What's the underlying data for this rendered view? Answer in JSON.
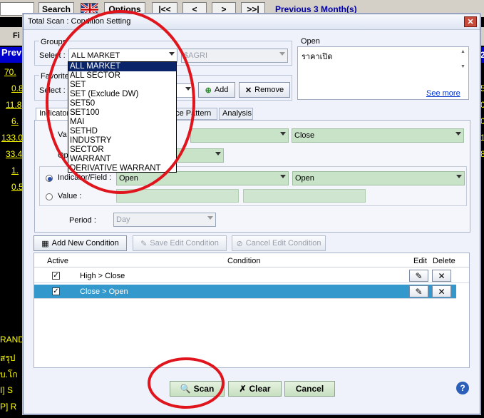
{
  "background": {
    "toolbar": {
      "search_label": "Search",
      "options_label": "Options",
      "first_label": "|<<",
      "prev_label": "<",
      "next_label": ">",
      "last_label": ">>|",
      "period_label": "Previous 3 Month(s)"
    },
    "tab_fragment": "Fi",
    "prev_header": "Prev",
    "prices": [
      "70.",
      "0.8",
      "11.8",
      "6.",
      "133.0",
      "33.4",
      "1.",
      "0.5"
    ],
    "news_lines": [
      "RAND",
      "สรุป",
      "บ.โก",
      "I] S",
      "P] R"
    ],
    "right_digits": [
      "2",
      "5",
      "0",
      "0",
      "1",
      "8",
      "1",
      "1"
    ]
  },
  "dialog": {
    "title": "Total Scan : Condition Setting",
    "groups": {
      "legend": "Groups",
      "select_label": "Select :",
      "selected": "ALL MARKET",
      "secondary": "$AGRI",
      "options": [
        "ALL MARKET",
        "ALL SECTOR",
        "SET",
        "SET (Exclude DW)",
        "SET50",
        "SET100",
        "MAI",
        "SETHD",
        "INDUSTRY",
        "SECTOR",
        "WARRANT",
        "DERIVATIVE WARRANT"
      ]
    },
    "favorites": {
      "legend": "Favorite",
      "select_label": "Select :",
      "add_label": "Add",
      "remove_label": "Remove"
    },
    "open_box": {
      "legend": "Open",
      "text": "ราคาเปิด",
      "see_more": "See more"
    },
    "tabs": [
      "Indicator",
      "rice Pattern",
      "Analysis"
    ],
    "condition": {
      "val_label": "Va",
      "op_label": "Op",
      "value_right": "Close",
      "indicator_label": "Indicator/Field :",
      "indicator_value": "Open",
      "indicator_right": "Open",
      "value_label": "Value :",
      "period_label": "Period :",
      "period_value": "Day"
    },
    "buttons": {
      "add_condition": "Add New Condition",
      "save_condition": "Save Edit Condition",
      "cancel_condition": "Cancel Edit Condition"
    },
    "grid": {
      "headers": {
        "active": "Active",
        "condition": "Condition",
        "edit": "Edit",
        "delete": "Delete"
      },
      "rows": [
        {
          "condition": "High > Close"
        },
        {
          "condition": "Close > Open"
        }
      ]
    },
    "footer": {
      "scan_label": "Scan",
      "clear_label": "Clear",
      "cancel_label": "Cancel"
    }
  },
  "colors": {
    "highlight": "#0a246a",
    "selected_row": "#3399cc",
    "annotation": "#e0141c"
  }
}
